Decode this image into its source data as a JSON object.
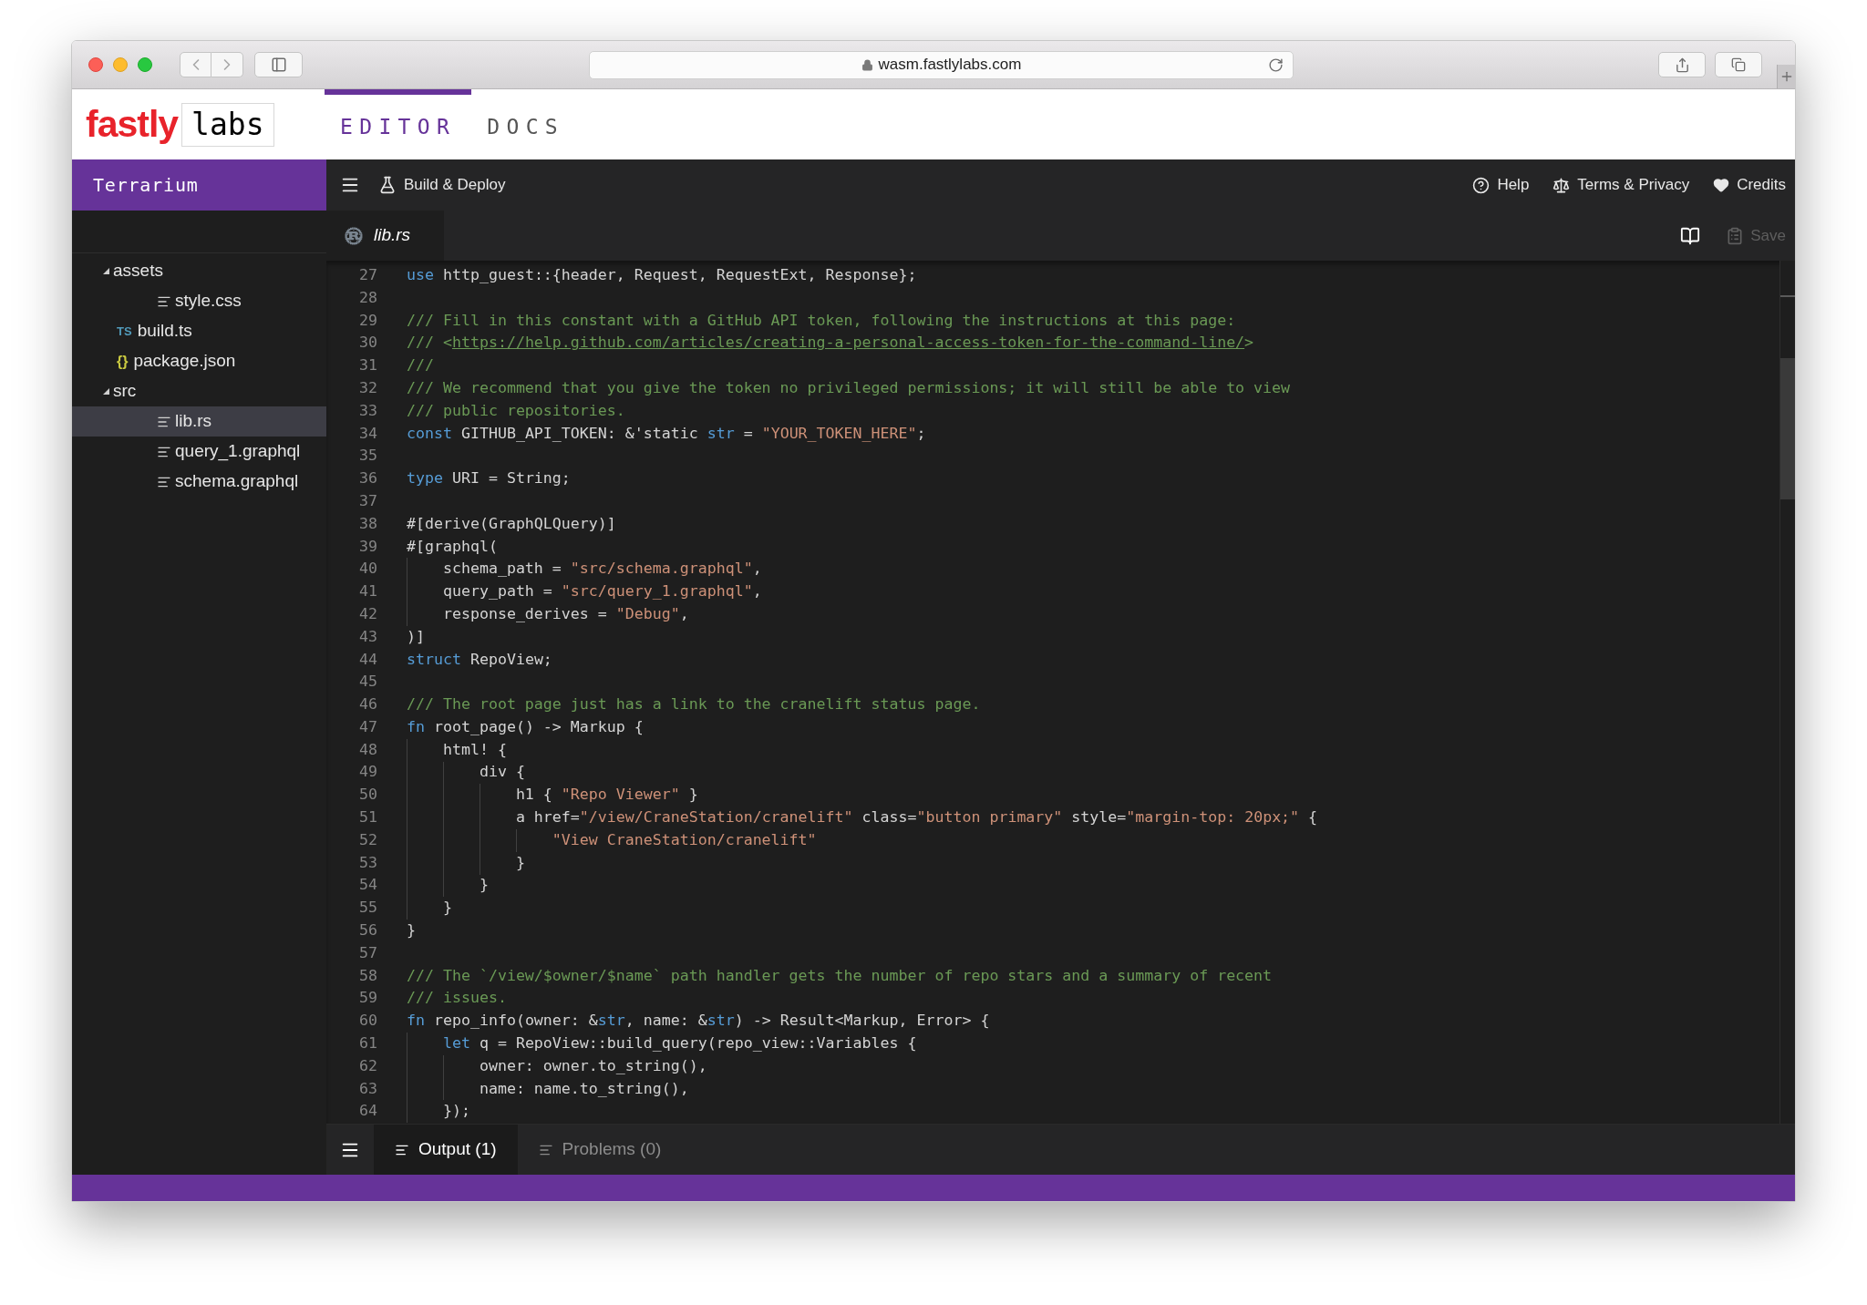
{
  "browser": {
    "url": "wasm.fastlylabs.com"
  },
  "header": {
    "logo": {
      "brand": "fastly",
      "suffix": "labs"
    },
    "tabs": [
      {
        "label": "EDITOR",
        "selected": true
      },
      {
        "label": "DOCS",
        "selected": false
      }
    ]
  },
  "sidebar": {
    "project": "Terrarium",
    "tree": [
      {
        "name": "assets",
        "kind": "folder",
        "expanded": true,
        "selected": false,
        "children": [
          {
            "name": "style.css",
            "kind": "text",
            "selected": false
          }
        ]
      },
      {
        "name": "build.ts",
        "kind": "ts",
        "badge": "TS",
        "selected": false
      },
      {
        "name": "package.json",
        "kind": "json",
        "badge": "{}",
        "selected": false
      },
      {
        "name": "src",
        "kind": "folder",
        "expanded": true,
        "selected": false,
        "children": [
          {
            "name": "lib.rs",
            "kind": "text",
            "selected": true
          },
          {
            "name": "query_1.graphql",
            "kind": "text",
            "selected": false
          },
          {
            "name": "schema.graphql",
            "kind": "text",
            "selected": false
          }
        ]
      }
    ]
  },
  "toolbar": {
    "actions": [
      {
        "label": "Build & Deploy",
        "kind": "build"
      }
    ],
    "links": [
      {
        "label": "Help",
        "kind": "help"
      },
      {
        "label": "Terms & Privacy",
        "kind": "terms"
      },
      {
        "label": "Credits",
        "kind": "credits"
      }
    ]
  },
  "editor": {
    "tabs": [
      {
        "label": "lib.rs",
        "selected": true
      }
    ],
    "save": {
      "label": "Save",
      "disabled": true
    },
    "lines": [
      {
        "number": "27",
        "tokens": [
          {
            "kind": "keyword",
            "text": "use"
          },
          {
            "kind": "plain",
            "text": " http_guest::{header, Request, RequestExt, Response};"
          }
        ]
      },
      {
        "number": "28"
      },
      {
        "number": "29",
        "tokens": [
          {
            "kind": "comment",
            "text": "/// Fill in this constant with a GitHub API token, following the instructions at this page:"
          }
        ]
      },
      {
        "number": "30",
        "tokens": [
          {
            "kind": "comment",
            "text": "/// <"
          },
          {
            "kind": "link",
            "text": "https://help.github.com/articles/creating-a-personal-access-token-for-the-command-line/"
          },
          {
            "kind": "comment",
            "text": ">"
          }
        ]
      },
      {
        "number": "31",
        "tokens": [
          {
            "kind": "comment",
            "text": "///"
          }
        ]
      },
      {
        "number": "32",
        "tokens": [
          {
            "kind": "comment",
            "text": "/// We recommend that you give the token no privileged permissions; it will still be able to view"
          }
        ]
      },
      {
        "number": "33",
        "tokens": [
          {
            "kind": "comment",
            "text": "/// public repositories."
          }
        ]
      },
      {
        "number": "34",
        "tokens": [
          {
            "kind": "keyword",
            "text": "const"
          },
          {
            "kind": "plain",
            "text": " GITHUB_API_TOKEN: &'static "
          },
          {
            "kind": "keyword",
            "text": "str"
          },
          {
            "kind": "plain",
            "text": " = "
          },
          {
            "kind": "string",
            "text": "\"YOUR_TOKEN_HERE\""
          },
          {
            "kind": "plain",
            "text": ";"
          }
        ]
      },
      {
        "number": "35"
      },
      {
        "number": "36",
        "tokens": [
          {
            "kind": "keyword",
            "text": "type"
          },
          {
            "kind": "plain",
            "text": " URI = String;"
          }
        ]
      },
      {
        "number": "37"
      },
      {
        "number": "38",
        "tokens": [
          {
            "kind": "plain",
            "text": "#[derive(GraphQLQuery)]"
          }
        ]
      },
      {
        "number": "39",
        "tokens": [
          {
            "kind": "plain",
            "text": "#[graphql("
          }
        ]
      },
      {
        "number": "40",
        "tokens": [
          {
            "kind": "plain",
            "text": "    schema_path = "
          },
          {
            "kind": "string",
            "text": "\"src/schema.graphql\""
          },
          {
            "kind": "plain",
            "text": ","
          }
        ]
      },
      {
        "number": "41",
        "tokens": [
          {
            "kind": "plain",
            "text": "    query_path = "
          },
          {
            "kind": "string",
            "text": "\"src/query_1.graphql\""
          },
          {
            "kind": "plain",
            "text": ","
          }
        ]
      },
      {
        "number": "42",
        "tokens": [
          {
            "kind": "plain",
            "text": "    response_derives = "
          },
          {
            "kind": "string",
            "text": "\"Debug\""
          },
          {
            "kind": "plain",
            "text": ","
          }
        ]
      },
      {
        "number": "43",
        "tokens": [
          {
            "kind": "plain",
            "text": ")]"
          }
        ]
      },
      {
        "number": "44",
        "tokens": [
          {
            "kind": "keyword",
            "text": "struct"
          },
          {
            "kind": "plain",
            "text": " RepoView;"
          }
        ]
      },
      {
        "number": "45"
      },
      {
        "number": "46",
        "tokens": [
          {
            "kind": "comment",
            "text": "/// The root page just has a link to the cranelift status page."
          }
        ]
      },
      {
        "number": "47",
        "tokens": [
          {
            "kind": "keyword",
            "text": "fn"
          },
          {
            "kind": "plain",
            "text": " root_page() -> Markup {"
          }
        ]
      },
      {
        "number": "48",
        "tokens": [
          {
            "kind": "plain",
            "text": "    html! {"
          }
        ]
      },
      {
        "number": "49",
        "tokens": [
          {
            "kind": "plain",
            "text": "        div {"
          }
        ]
      },
      {
        "number": "50",
        "tokens": [
          {
            "kind": "plain",
            "text": "            h1 { "
          },
          {
            "kind": "string",
            "text": "\"Repo Viewer\""
          },
          {
            "kind": "plain",
            "text": " }"
          }
        ]
      },
      {
        "number": "51",
        "tokens": [
          {
            "kind": "plain",
            "text": "            a href="
          },
          {
            "kind": "string",
            "text": "\"/view/CraneStation/cranelift\""
          },
          {
            "kind": "plain",
            "text": " class="
          },
          {
            "kind": "string",
            "text": "\"button primary\""
          },
          {
            "kind": "plain",
            "text": " style="
          },
          {
            "kind": "string",
            "text": "\"margin-top: 20px;\""
          },
          {
            "kind": "plain",
            "text": " {"
          }
        ]
      },
      {
        "number": "52",
        "tokens": [
          {
            "kind": "string",
            "text": "                \"View CraneStation/cranelift\""
          }
        ]
      },
      {
        "number": "53",
        "tokens": [
          {
            "kind": "plain",
            "text": "            }"
          }
        ]
      },
      {
        "number": "54",
        "tokens": [
          {
            "kind": "plain",
            "text": "        }"
          }
        ]
      },
      {
        "number": "55",
        "tokens": [
          {
            "kind": "plain",
            "text": "    }"
          }
        ]
      },
      {
        "number": "56",
        "tokens": [
          {
            "kind": "plain",
            "text": "}"
          }
        ]
      },
      {
        "number": "57"
      },
      {
        "number": "58",
        "tokens": [
          {
            "kind": "comment",
            "text": "/// The `/view/$owner/$name` path handler gets the number of repo stars and a summary of recent"
          }
        ]
      },
      {
        "number": "59",
        "tokens": [
          {
            "kind": "comment",
            "text": "/// issues."
          }
        ]
      },
      {
        "number": "60",
        "tokens": [
          {
            "kind": "keyword",
            "text": "fn"
          },
          {
            "kind": "plain",
            "text": " repo_info(owner: &"
          },
          {
            "kind": "keyword",
            "text": "str"
          },
          {
            "kind": "plain",
            "text": ", name: &"
          },
          {
            "kind": "keyword",
            "text": "str"
          },
          {
            "kind": "plain",
            "text": ") -> Result<Markup, Error> {"
          }
        ]
      },
      {
        "number": "61",
        "tokens": [
          {
            "kind": "keyword",
            "text": "    let"
          },
          {
            "kind": "plain",
            "text": " q = RepoView::build_query(repo_view::Variables {"
          }
        ]
      },
      {
        "number": "62",
        "tokens": [
          {
            "kind": "plain",
            "text": "        owner: owner.to_string(),"
          }
        ]
      },
      {
        "number": "63",
        "tokens": [
          {
            "kind": "plain",
            "text": "        name: name.to_string(),"
          }
        ]
      },
      {
        "number": "64",
        "tokens": [
          {
            "kind": "plain",
            "text": "    });"
          }
        ]
      }
    ]
  },
  "panel": {
    "tabs": [
      {
        "label": "Output (1)",
        "selected": true
      },
      {
        "label": "Problems (0)",
        "selected": false
      }
    ]
  }
}
